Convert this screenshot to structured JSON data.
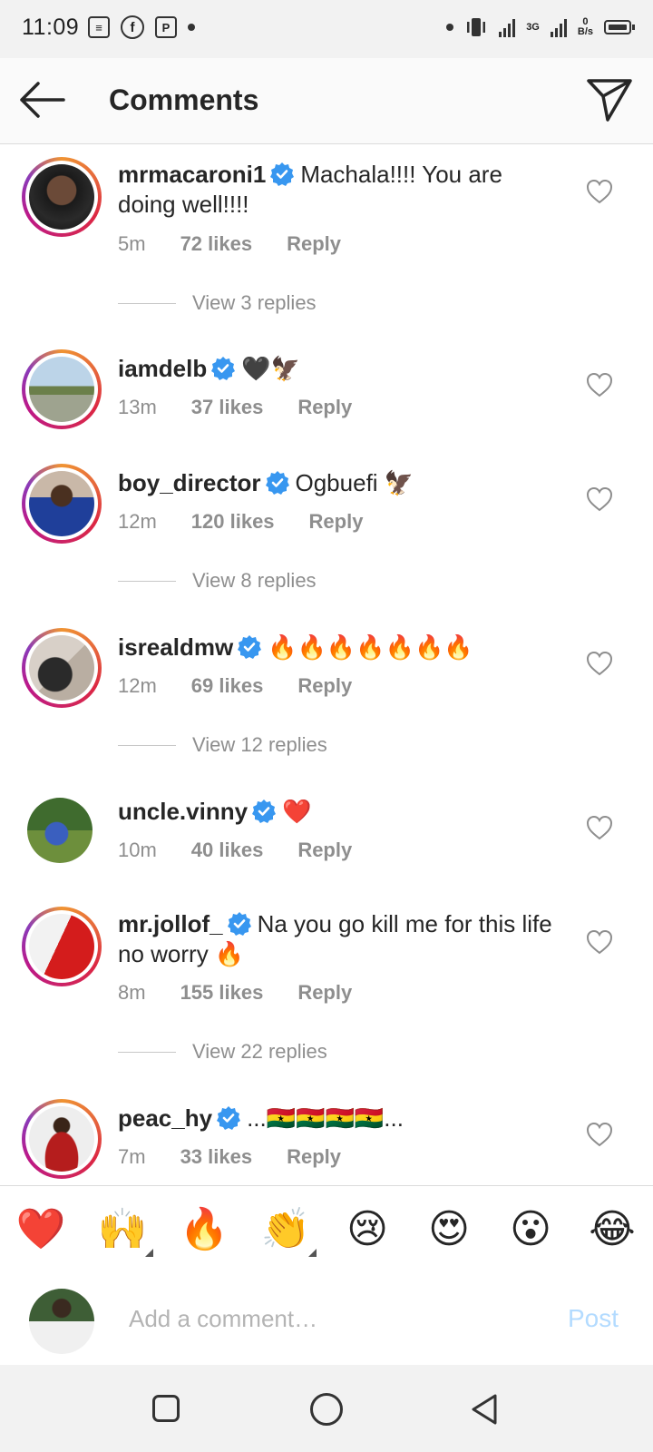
{
  "status_bar": {
    "time": "11:09",
    "network_type": "3G",
    "speed_value": "0",
    "speed_unit": "B/s"
  },
  "header": {
    "title": "Comments"
  },
  "colors": {
    "verified": "#3897f0",
    "heart_red": "#e0242f",
    "meta_gray": "#8e8e8e",
    "post_disabled": "#b3dbff"
  },
  "comments": [
    {
      "username": "mrmacaroni1",
      "text": "Machala!!!! You are doing well!!!!",
      "time": "5m",
      "likes": "72 likes",
      "reply": "Reply",
      "view_replies": "View 3 replies"
    },
    {
      "username": "iamdelb",
      "text": "🖤🦅",
      "time": "13m",
      "likes": "37 likes",
      "reply": "Reply"
    },
    {
      "username": "boy_director",
      "text": "Ogbuefi 🦅",
      "time": "12m",
      "likes": "120 likes",
      "reply": "Reply",
      "view_replies": "View 8 replies"
    },
    {
      "username": "isrealdmw",
      "text": "🔥🔥🔥🔥🔥🔥🔥",
      "time": "12m",
      "likes": "69 likes",
      "reply": "Reply",
      "view_replies": "View 12 replies"
    },
    {
      "username": "uncle.vinny",
      "text": "❤️",
      "time": "10m",
      "likes": "40 likes",
      "reply": "Reply"
    },
    {
      "username": "mr.jollof_",
      "text": "Na you go kill me for this life no worry 🔥",
      "time": "8m",
      "likes": "155 likes",
      "reply": "Reply",
      "view_replies": "View 22 replies"
    },
    {
      "username": "peac_hy",
      "text": "...🇬🇭🇬🇭🇬🇭🇬🇭...",
      "time": "7m",
      "likes": "33 likes",
      "reply": "Reply"
    }
  ],
  "emoji_bar": [
    "❤️",
    "🙌",
    "🔥",
    "👏",
    "😢",
    "😍",
    "😮",
    "😂"
  ],
  "composer": {
    "placeholder": "Add a comment…",
    "post_label": "Post"
  }
}
